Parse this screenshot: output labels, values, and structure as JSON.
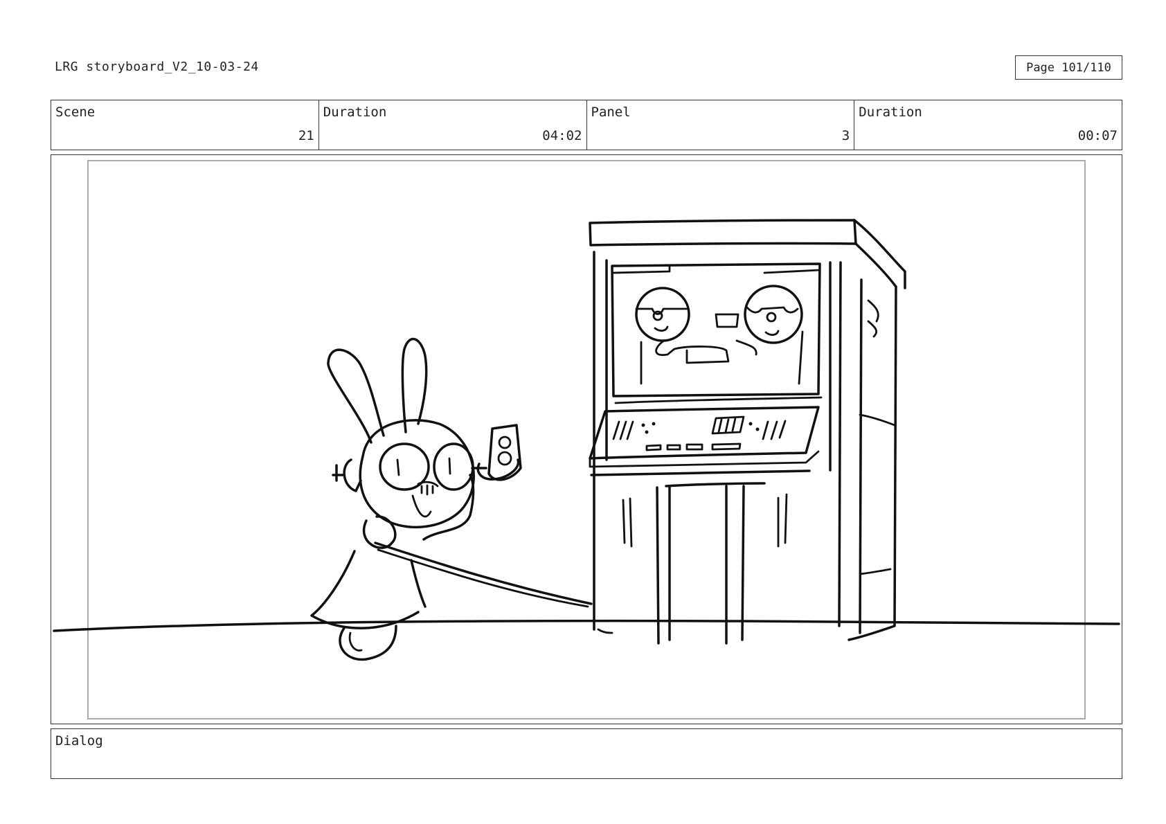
{
  "document": {
    "title": "LRG storyboard_V2_10-03-24",
    "page_label": "Page 101/110"
  },
  "info": {
    "scene_label": "Scene",
    "scene_value": "21",
    "scene_duration_label": "Duration",
    "scene_duration_value": "04:02",
    "panel_label": "Panel",
    "panel_value": "3",
    "panel_duration_label": "Duration",
    "panel_duration_value": "00:07"
  },
  "dialog": {
    "label": "Dialog",
    "text": ""
  }
}
